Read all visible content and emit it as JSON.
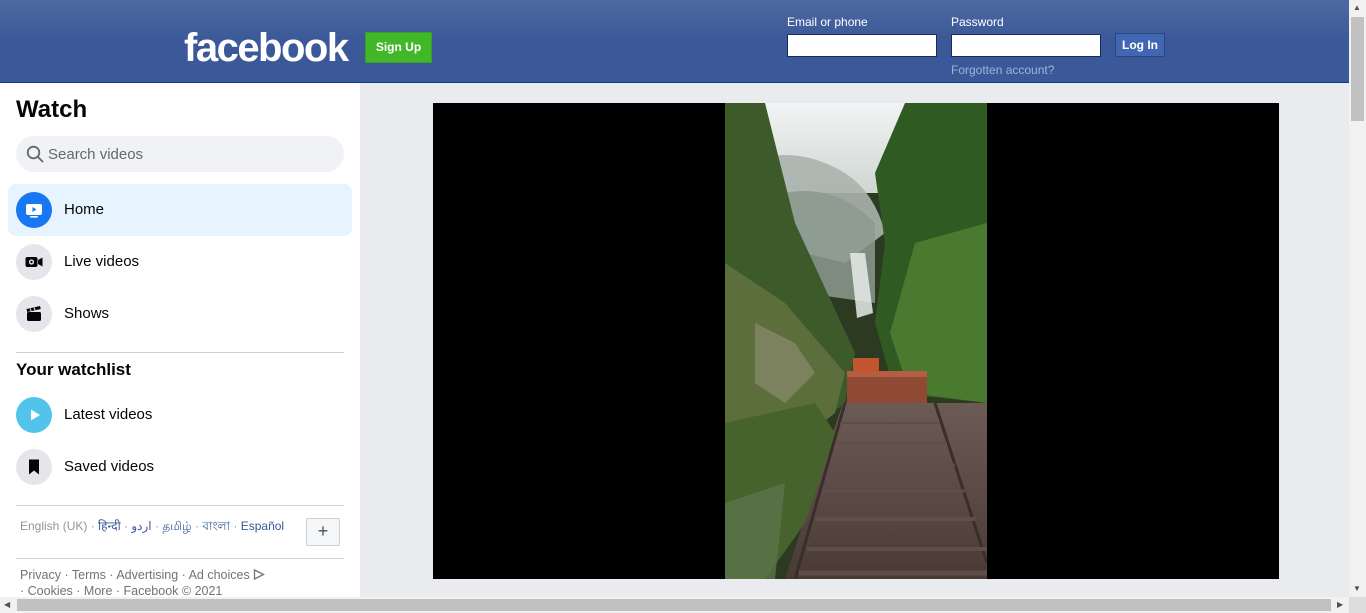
{
  "header": {
    "logo_text": "facebook",
    "signup_label": "Sign Up",
    "email_label": "Email or phone",
    "password_label": "Password",
    "login_label": "Log In",
    "forgot_label": "Forgotten account?"
  },
  "sidebar": {
    "title": "Watch",
    "search_placeholder": "Search videos",
    "nav": [
      {
        "label": "Home",
        "icon": "tv-play-icon"
      },
      {
        "label": "Live videos",
        "icon": "live-camera-icon"
      },
      {
        "label": "Shows",
        "icon": "clapperboard-icon"
      }
    ],
    "watchlist_title": "Your watchlist",
    "watchlist": [
      {
        "label": "Latest videos",
        "icon": "play-icon"
      },
      {
        "label": "Saved videos",
        "icon": "bookmark-icon"
      }
    ],
    "languages": {
      "current": "English (UK)",
      "others": [
        "हिन्दी",
        "اردو",
        "தமிழ்",
        "বাংলা",
        "Español"
      ],
      "more_label": "+"
    },
    "footer": {
      "links": [
        "Privacy",
        "Terms",
        "Advertising",
        "Ad choices",
        "Cookies",
        "More"
      ],
      "copyright": "Facebook © 2021"
    }
  },
  "colors": {
    "header_bg": "#3b5998",
    "signup_green": "#42b72a",
    "active_bg": "#e7f3ff",
    "brand_blue": "#1877f2"
  }
}
